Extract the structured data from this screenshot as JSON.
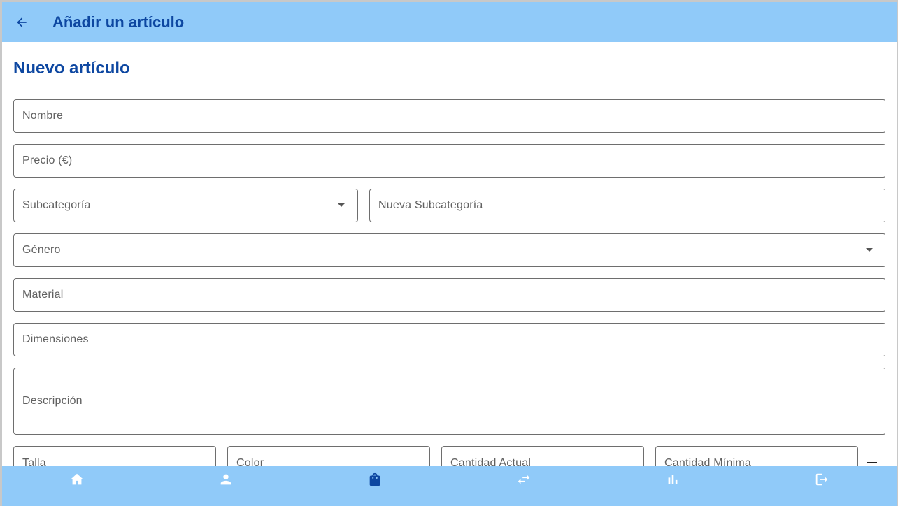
{
  "appbar": {
    "title": "Añadir un artículo",
    "back_icon": "arrow-back-icon"
  },
  "form": {
    "heading": "Nuevo artículo",
    "fields": {
      "nombre": {
        "label": "Nombre",
        "value": ""
      },
      "precio": {
        "label": "Precio (€)",
        "value": ""
      },
      "subcategoria": {
        "label": "Subcategoría",
        "value": ""
      },
      "nueva_subcategoria": {
        "label": "Nueva Subcategoría",
        "value": ""
      },
      "genero": {
        "label": "Género",
        "value": ""
      },
      "material": {
        "label": "Material",
        "value": ""
      },
      "dimensiones": {
        "label": "Dimensiones",
        "value": ""
      },
      "descripcion": {
        "label": "Descripción",
        "value": ""
      },
      "talla": {
        "label": "Talla",
        "value": ""
      },
      "color": {
        "label": "Color",
        "value": ""
      },
      "cantidad_actual": {
        "label": "Cantidad Actual",
        "value": ""
      },
      "cantidad_minima": {
        "label": "Cantidad Mínima",
        "value": ""
      }
    },
    "remove_icon": "minus-icon"
  },
  "bottom_nav": {
    "items": [
      {
        "icon": "home-icon",
        "active": false
      },
      {
        "icon": "person-icon",
        "active": false
      },
      {
        "icon": "shopping-bag-icon",
        "active": true
      },
      {
        "icon": "swap-arrows-icon",
        "active": false
      },
      {
        "icon": "bar-chart-icon",
        "active": false
      },
      {
        "icon": "logout-icon",
        "active": false
      }
    ]
  },
  "colors": {
    "bar_background": "#90caf9",
    "primary_dark": "#0d47a1",
    "nav_icon": "#ffffff",
    "field_border": "#6e6e6e",
    "placeholder": "#616161"
  }
}
